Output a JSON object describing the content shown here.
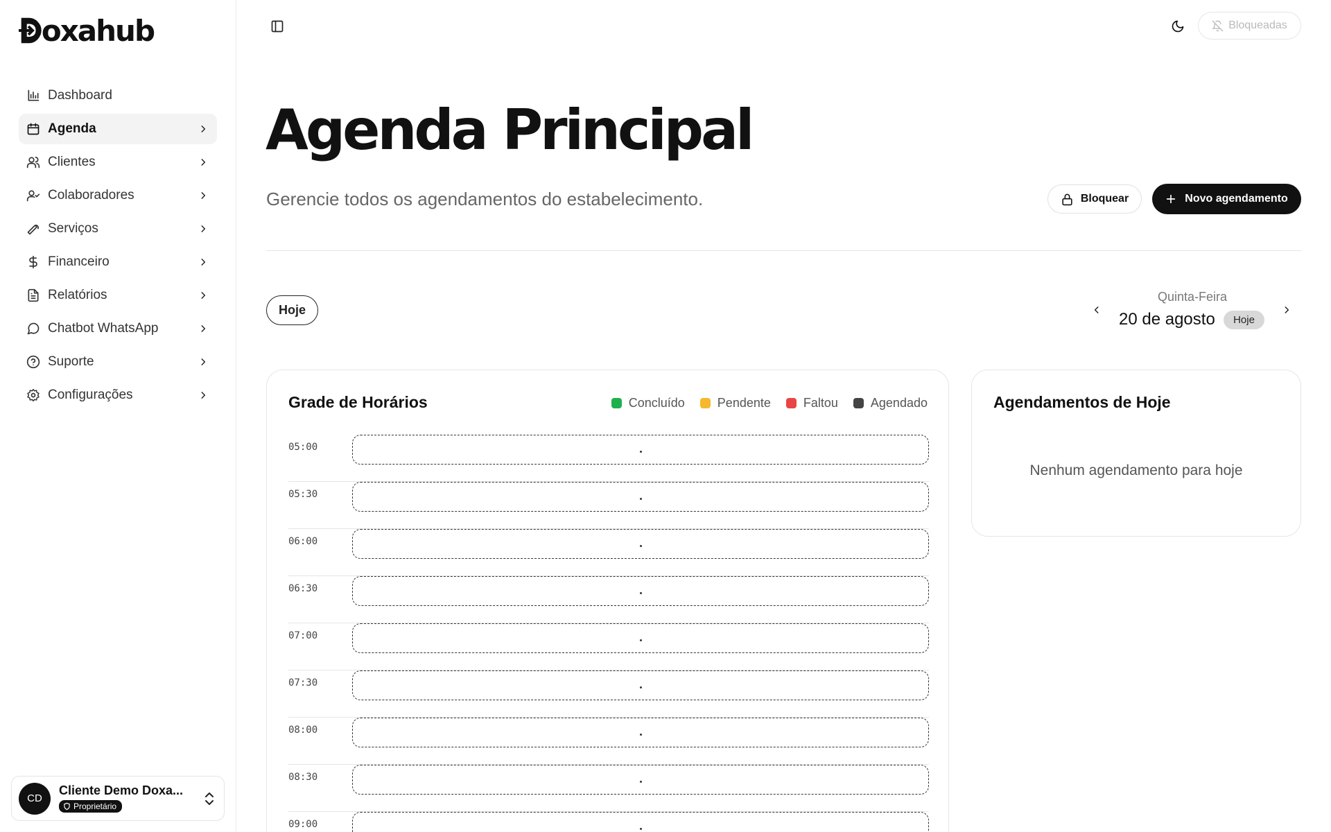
{
  "app": {
    "logo_text": "Doxahub"
  },
  "sidebar": {
    "items": [
      {
        "label": "Dashboard",
        "icon": "bar-chart-icon"
      },
      {
        "label": "Agenda",
        "icon": "calendar-icon"
      },
      {
        "label": "Clientes",
        "icon": "users-icon"
      },
      {
        "label": "Colaboradores",
        "icon": "user-check-icon"
      },
      {
        "label": "Serviços",
        "icon": "wrench-icon"
      },
      {
        "label": "Financeiro",
        "icon": "dollar-icon"
      },
      {
        "label": "Relatórios",
        "icon": "file-text-icon"
      },
      {
        "label": "Chatbot WhatsApp",
        "icon": "message-circle-icon"
      },
      {
        "label": "Suporte",
        "icon": "help-circle-icon"
      },
      {
        "label": "Configurações",
        "icon": "settings-icon"
      }
    ],
    "active_index": 1
  },
  "user": {
    "initials": "CD",
    "name": "Cliente Demo Doxa...",
    "role": "Proprietário"
  },
  "topbar": {
    "blocked_label": "Bloqueadas"
  },
  "header": {
    "title": "Agenda Principal",
    "subtitle": "Gerencie todos os agendamentos do estabelecimento.",
    "block_button": "Bloquear",
    "new_button": "Novo agendamento"
  },
  "date_nav": {
    "today_button": "Hoje",
    "weekday": "Quinta-Feira",
    "date": "20 de agosto",
    "today_badge": "Hoje"
  },
  "schedule": {
    "title": "Grade de Horários",
    "legend": [
      {
        "label": "Concluído",
        "color": "#1fb04d"
      },
      {
        "label": "Pendente",
        "color": "#f5b82e"
      },
      {
        "label": "Faltou",
        "color": "#e84545"
      },
      {
        "label": "Agendado",
        "color": "#444444"
      }
    ],
    "slots": [
      "05:00",
      "05:30",
      "06:00",
      "06:30",
      "07:00",
      "07:30",
      "08:00",
      "08:30",
      "09:00"
    ]
  },
  "today_panel": {
    "title": "Agendamentos de Hoje",
    "empty_message": "Nenhum agendamento para hoje"
  }
}
